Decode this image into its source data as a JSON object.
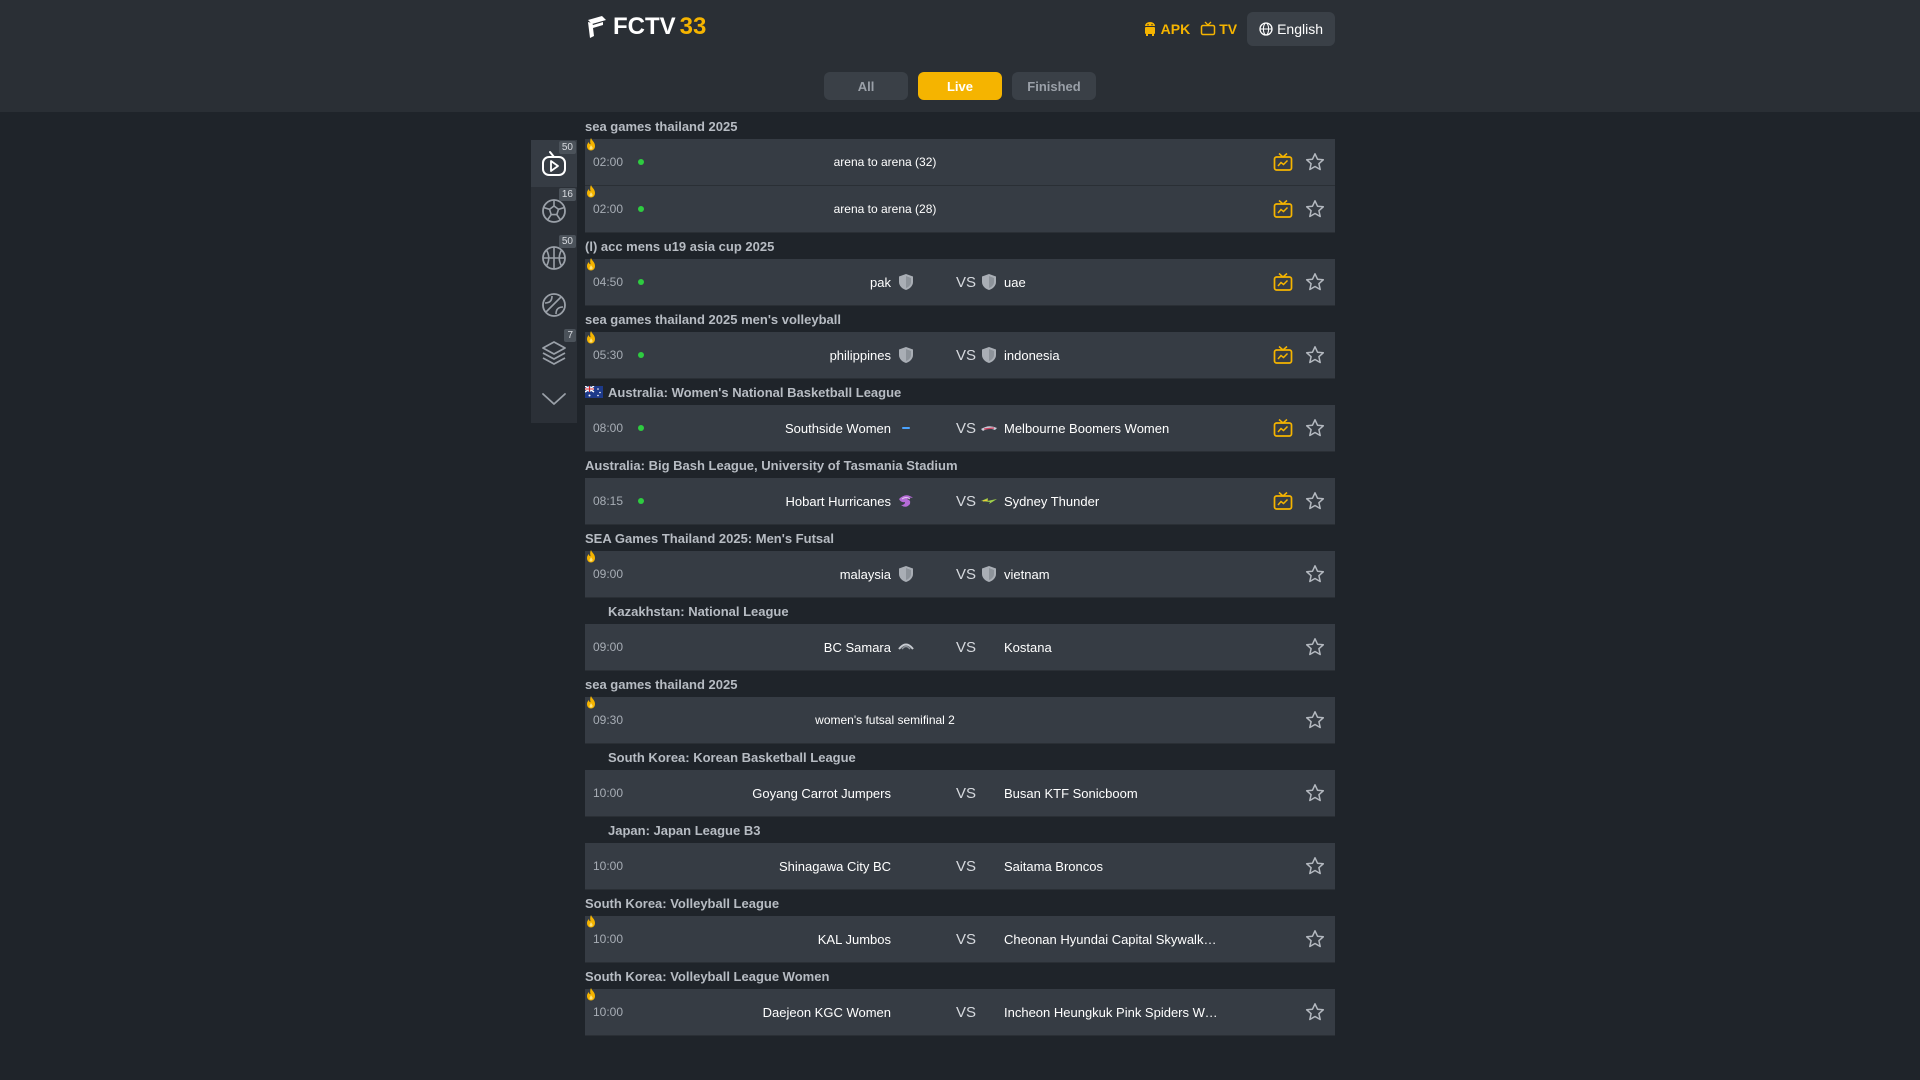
{
  "header": {
    "logo_text": "FCTV",
    "logo_accent": "33",
    "apk_label": "APK",
    "tv_label": "TV",
    "language": "English"
  },
  "tabs": [
    {
      "label": "All",
      "active": false
    },
    {
      "label": "Live",
      "active": true
    },
    {
      "label": "Finished",
      "active": false
    }
  ],
  "sidebar": [
    {
      "icon": "live-tv-icon",
      "badge": "50",
      "active": true
    },
    {
      "icon": "football-icon",
      "badge": "16",
      "active": false
    },
    {
      "icon": "basketball-icon",
      "badge": "50",
      "active": false
    },
    {
      "icon": "tennis-icon",
      "badge": "",
      "active": false
    },
    {
      "icon": "layers-icon",
      "badge": "7",
      "active": false
    },
    {
      "icon": "chevron-down-icon",
      "badge": "",
      "active": false
    }
  ],
  "groups": [
    {
      "league": "sea games thailand 2025",
      "flag": "",
      "matches": [
        {
          "time": "02:00",
          "live": true,
          "hot": true,
          "title": "arena to arena (32)",
          "tv": true
        },
        {
          "time": "02:00",
          "live": true,
          "hot": true,
          "title": "arena to arena (28)",
          "tv": true
        }
      ]
    },
    {
      "league": "(l) acc mens u19 asia cup 2025",
      "flag": "",
      "matches": [
        {
          "time": "04:50",
          "live": true,
          "hot": true,
          "home": "pak",
          "away": "uae",
          "home_logo": "shield",
          "away_logo": "shield",
          "tv": true
        }
      ]
    },
    {
      "league": "sea games thailand 2025 men's volleyball",
      "flag": "",
      "matches": [
        {
          "time": "05:30",
          "live": true,
          "hot": true,
          "home": "philippines",
          "away": "indonesia",
          "home_logo": "shield",
          "away_logo": "shield",
          "tv": true
        }
      ]
    },
    {
      "league": "Australia: Women's National Basketball League",
      "flag": "australia",
      "matches": [
        {
          "time": "08:00",
          "live": true,
          "hot": false,
          "home": "Southside Women",
          "away": "Melbourne Boomers Women",
          "home_logo": "dash",
          "away_logo": "boomers",
          "tv": true
        }
      ]
    },
    {
      "league": "Australia: Big Bash League, University of Tasmania Stadium",
      "flag": "",
      "matches": [
        {
          "time": "08:15",
          "live": true,
          "hot": false,
          "home": "Hobart Hurricanes",
          "away": "Sydney Thunder",
          "home_logo": "hurricanes",
          "away_logo": "thunder",
          "tv": true
        }
      ]
    },
    {
      "league": "SEA Games Thailand 2025: Men's Futsal",
      "flag": "",
      "matches": [
        {
          "time": "09:00",
          "live": false,
          "hot": true,
          "home": "malaysia",
          "away": "vietnam",
          "home_logo": "shield",
          "away_logo": "shield",
          "tv": false
        }
      ]
    },
    {
      "league": "Kazakhstan: National League",
      "flag": "blank",
      "matches": [
        {
          "time": "09:00",
          "live": false,
          "hot": false,
          "home": "BC Samara",
          "away": "Kostana",
          "home_logo": "samara",
          "away_logo": "",
          "tv": false
        }
      ]
    },
    {
      "league": "sea games thailand 2025",
      "flag": "",
      "matches": [
        {
          "time": "09:30",
          "live": false,
          "hot": true,
          "title": "women's futsal semifinal 2",
          "tv": false
        }
      ]
    },
    {
      "league": "South Korea: Korean Basketball League",
      "flag": "blank",
      "matches": [
        {
          "time": "10:00",
          "live": false,
          "hot": false,
          "home": "Goyang Carrot Jumpers",
          "away": "Busan KTF Sonicboom",
          "home_logo": "",
          "away_logo": "",
          "tv": false
        }
      ]
    },
    {
      "league": "Japan: Japan League B3",
      "flag": "blank",
      "matches": [
        {
          "time": "10:00",
          "live": false,
          "hot": false,
          "home": "Shinagawa City BC",
          "away": "Saitama Broncos",
          "home_logo": "",
          "away_logo": "",
          "tv": false
        }
      ]
    },
    {
      "league": "South Korea: Volleyball League",
      "flag": "",
      "matches": [
        {
          "time": "10:00",
          "live": false,
          "hot": true,
          "home": "KAL Jumbos",
          "away": "Cheonan Hyundai Capital Skywalkers",
          "home_logo": "",
          "away_logo": "",
          "tv": false
        }
      ]
    },
    {
      "league": "South Korea: Volleyball League Women",
      "flag": "",
      "matches": [
        {
          "time": "10:00",
          "live": false,
          "hot": true,
          "home": "Daejeon KGC Women",
          "away": "Incheon Heungkuk Pink Spiders Women",
          "home_logo": "",
          "away_logo": "",
          "tv": false
        }
      ]
    }
  ],
  "colors": {
    "accent": "#f5b400",
    "live": "#2ecc40",
    "row": "#363c44",
    "background": "#1f242a"
  }
}
